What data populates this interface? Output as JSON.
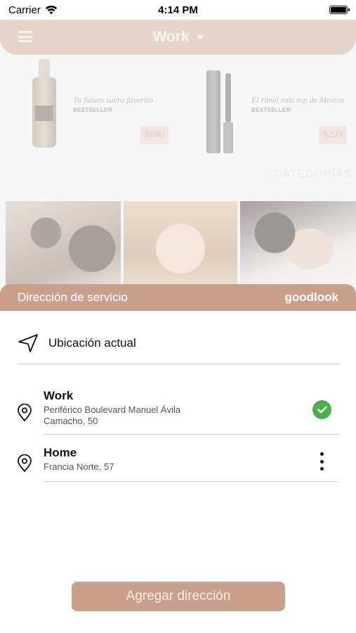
{
  "status_bar": {
    "carrier": "Carrier",
    "time": "4:14 PM"
  },
  "navbar": {
    "title": "Work",
    "menu_icon": "hamburger-icon",
    "caret_icon": "caret-down-icon"
  },
  "products": [
    {
      "tagline": "Tu futuro suero favorito",
      "badge": "BESTSELLER",
      "price": "$690"
    },
    {
      "tagline": "El rímel más top de México",
      "badge": "BESTSELLER",
      "price": "$299"
    }
  ],
  "categories_title": "CATEGORÍAS",
  "sheet": {
    "title": "Dirección de servicio",
    "brand": "goodlook",
    "current_location": {
      "icon": "navigation-arrow-icon",
      "label": "Ubicación actual"
    },
    "addresses": [
      {
        "name": "Work",
        "line1": "Periférico Boulevard Manuel Ávila",
        "line2": "Camacho, 50",
        "icon": "location-pin-icon",
        "selected": true,
        "status_icon": "check-circle-icon"
      },
      {
        "name": "Home",
        "line1": "Francia Norte, 57",
        "icon": "location-pin-icon",
        "selected": false,
        "status_icon": "more-vertical-icon"
      }
    ],
    "add_button": "Agregar dirección"
  },
  "colors": {
    "accent": "#c9a08c",
    "success": "#4caf50"
  }
}
